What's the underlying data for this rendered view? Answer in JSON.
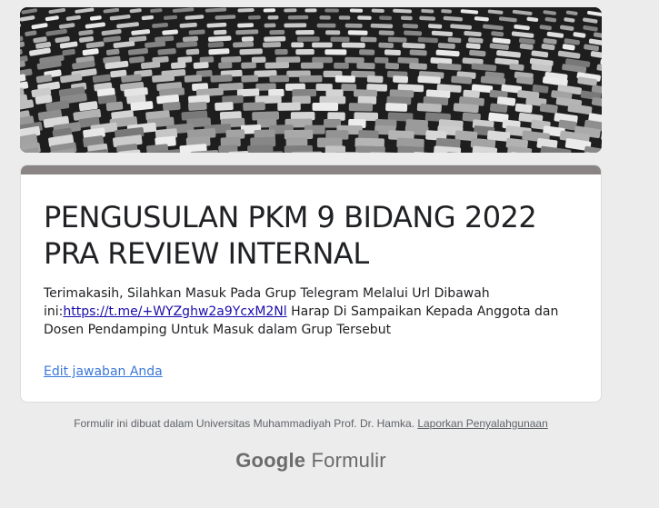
{
  "header": {
    "image_icon": "cobblestone-photo"
  },
  "form": {
    "title": "PENGUSULAN PKM 9 BIDANG 2022 PRA REVIEW INTERNAL",
    "message_before_link": "Terimakasih, Silahkan Masuk Pada Grup Telegram Melalui Url Dibawah ini:",
    "message_link": "https://t.me/+WYZghw2a9YcxM2Nl",
    "message_after_link": " Harap Di Sampaikan Kepada Anggota dan Dosen Pendamping Untuk Masuk dalam Grup Tersebut",
    "edit_link": "Edit jawaban Anda",
    "accent_color": "#8a8584"
  },
  "footer": {
    "created_text": "Formulir ini dibuat dalam Universitas Muhammadiyah Prof. Dr. Hamka. ",
    "report_link": "Laporkan Penyalahgunaan",
    "brand_google": "Google",
    "brand_product": " Formulir"
  }
}
